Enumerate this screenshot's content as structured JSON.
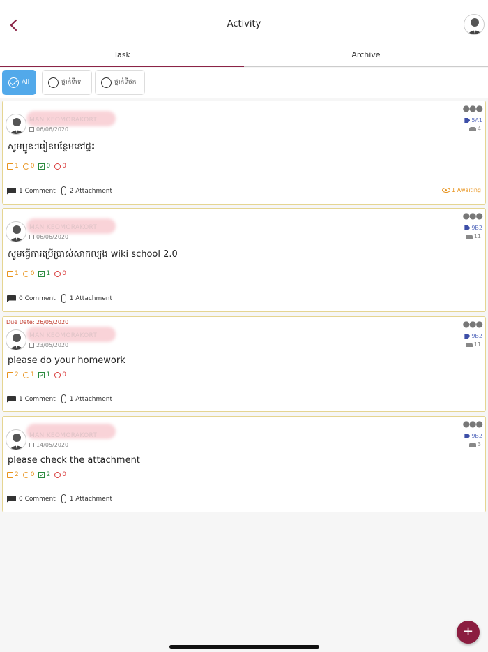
{
  "header": {
    "title": "Activity"
  },
  "tabs": [
    {
      "label": "Task",
      "active": true
    },
    {
      "label": "Archive",
      "active": false
    }
  ],
  "filters": [
    {
      "label": "All",
      "active": true
    },
    {
      "label": "ថ្នាក់ទីទេ",
      "active": false
    },
    {
      "label": "ថ្នាក់ទីថក",
      "active": false
    }
  ],
  "cards": [
    {
      "due_date": "",
      "author": "MAN KEOMORAKORT",
      "date": "06/06/2020",
      "class_tag": "5A1",
      "members": "4",
      "text": "សូមប្អូនៗរៀនបន្ថែមនៅផ្ទះ",
      "stats": {
        "docs": "1",
        "refresh": "0",
        "checked": "0",
        "rejected": "0"
      },
      "comments": "1 Comment",
      "attachments": "2 Attachment",
      "awaiting": "1 Awaiting"
    },
    {
      "due_date": "",
      "author": "MAN KEOMORAKORT",
      "date": "06/06/2020",
      "class_tag": "9B2",
      "members": "11",
      "text": "សូមធ្វើការប្រើប្រាស់សាកល្បង wiki school 2.0",
      "stats": {
        "docs": "1",
        "refresh": "0",
        "checked": "1",
        "rejected": "0"
      },
      "comments": "0 Comment",
      "attachments": "1 Attachment",
      "awaiting": ""
    },
    {
      "due_date": "Due Date: 26/05/2020",
      "author": "MAN KEOMORAKORT",
      "date": "23/05/2020",
      "class_tag": "9B2",
      "members": "11",
      "text": "please do your homework",
      "stats": {
        "docs": "2",
        "refresh": "1",
        "checked": "1",
        "rejected": "0"
      },
      "comments": "1 Comment",
      "attachments": "1 Attachment",
      "awaiting": ""
    },
    {
      "due_date": "",
      "author": "MAN KEOMORAKORT",
      "date": "14/05/2020",
      "class_tag": "9B2",
      "members": "3",
      "text": "please check the attachment",
      "stats": {
        "docs": "2",
        "refresh": "0",
        "checked": "2",
        "rejected": "0"
      },
      "comments": "0 Comment",
      "attachments": "1 Attachment",
      "awaiting": ""
    }
  ],
  "fab": {
    "label": "+"
  },
  "colors": {
    "accent": "#8b2346",
    "chip_active": "#52a9ea",
    "card_border": "#e5d592",
    "tag": "#5b6fbf",
    "awaiting": "#e8931c"
  }
}
